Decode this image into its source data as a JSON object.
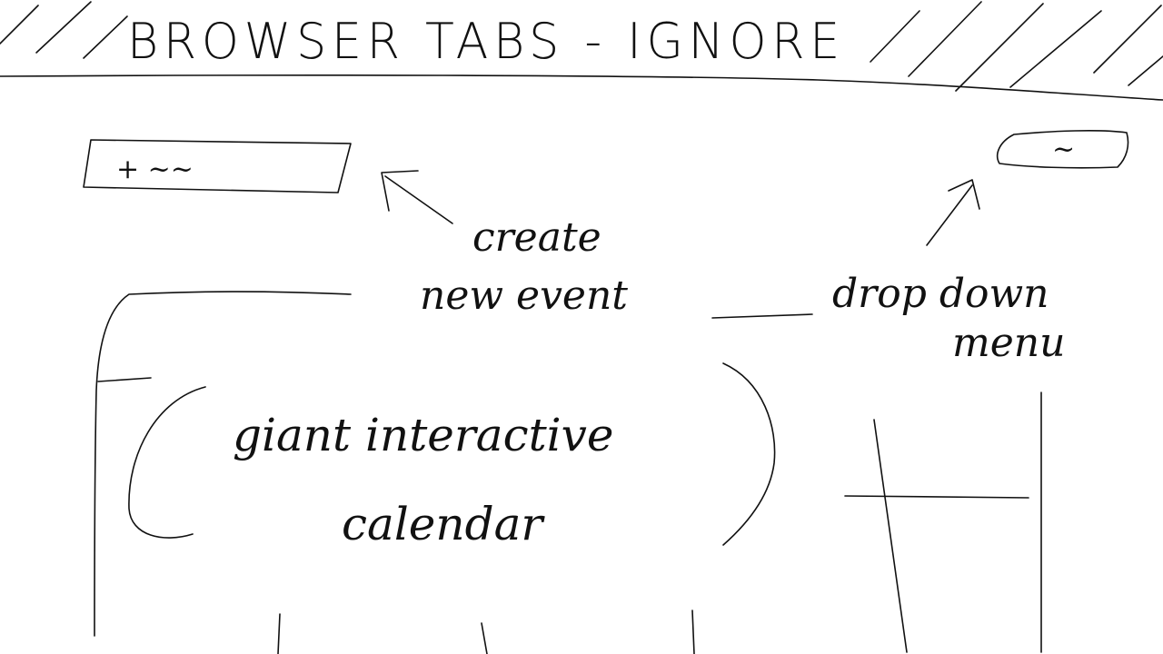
{
  "browser_bar": {
    "title": "BROWSER TABS - IGNORE"
  },
  "toolbar": {
    "create_button_label": "+ ~~",
    "menu_button_label": "~"
  },
  "annotations": {
    "create_line1": "create",
    "create_line2": "new event",
    "dropdown_line1": "drop down",
    "dropdown_line2": "menu"
  },
  "main": {
    "calendar_line1": "giant interactive",
    "calendar_line2": "calendar"
  }
}
